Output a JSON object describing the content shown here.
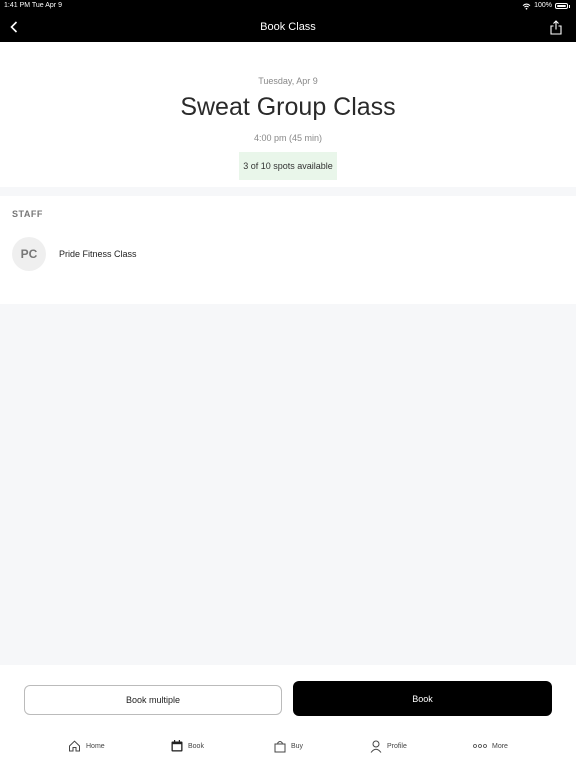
{
  "status_bar": {
    "time": "1:41 PM  Tue Apr 9",
    "battery": "100%"
  },
  "nav": {
    "title": "Book Class"
  },
  "class_info": {
    "date": "Tuesday, Apr 9",
    "title": "Sweat Group Class",
    "time": "4:00 pm (45 min)",
    "spots": "3 of 10 spots available"
  },
  "staff": {
    "header": "STAFF",
    "members": [
      {
        "initials": "PC",
        "name": "Pride Fitness Class"
      }
    ]
  },
  "actions": {
    "book_multiple": "Book multiple",
    "book": "Book"
  },
  "tabs": [
    {
      "label": "Home",
      "icon": "home-icon"
    },
    {
      "label": "Book",
      "icon": "calendar-icon"
    },
    {
      "label": "Buy",
      "icon": "shopping-bag-icon"
    },
    {
      "label": "Profile",
      "icon": "person-icon"
    },
    {
      "label": "More",
      "icon": "more-dots-icon"
    }
  ],
  "colors": {
    "accent": "#000000",
    "spots_badge_bg": "#e9f6ea"
  }
}
